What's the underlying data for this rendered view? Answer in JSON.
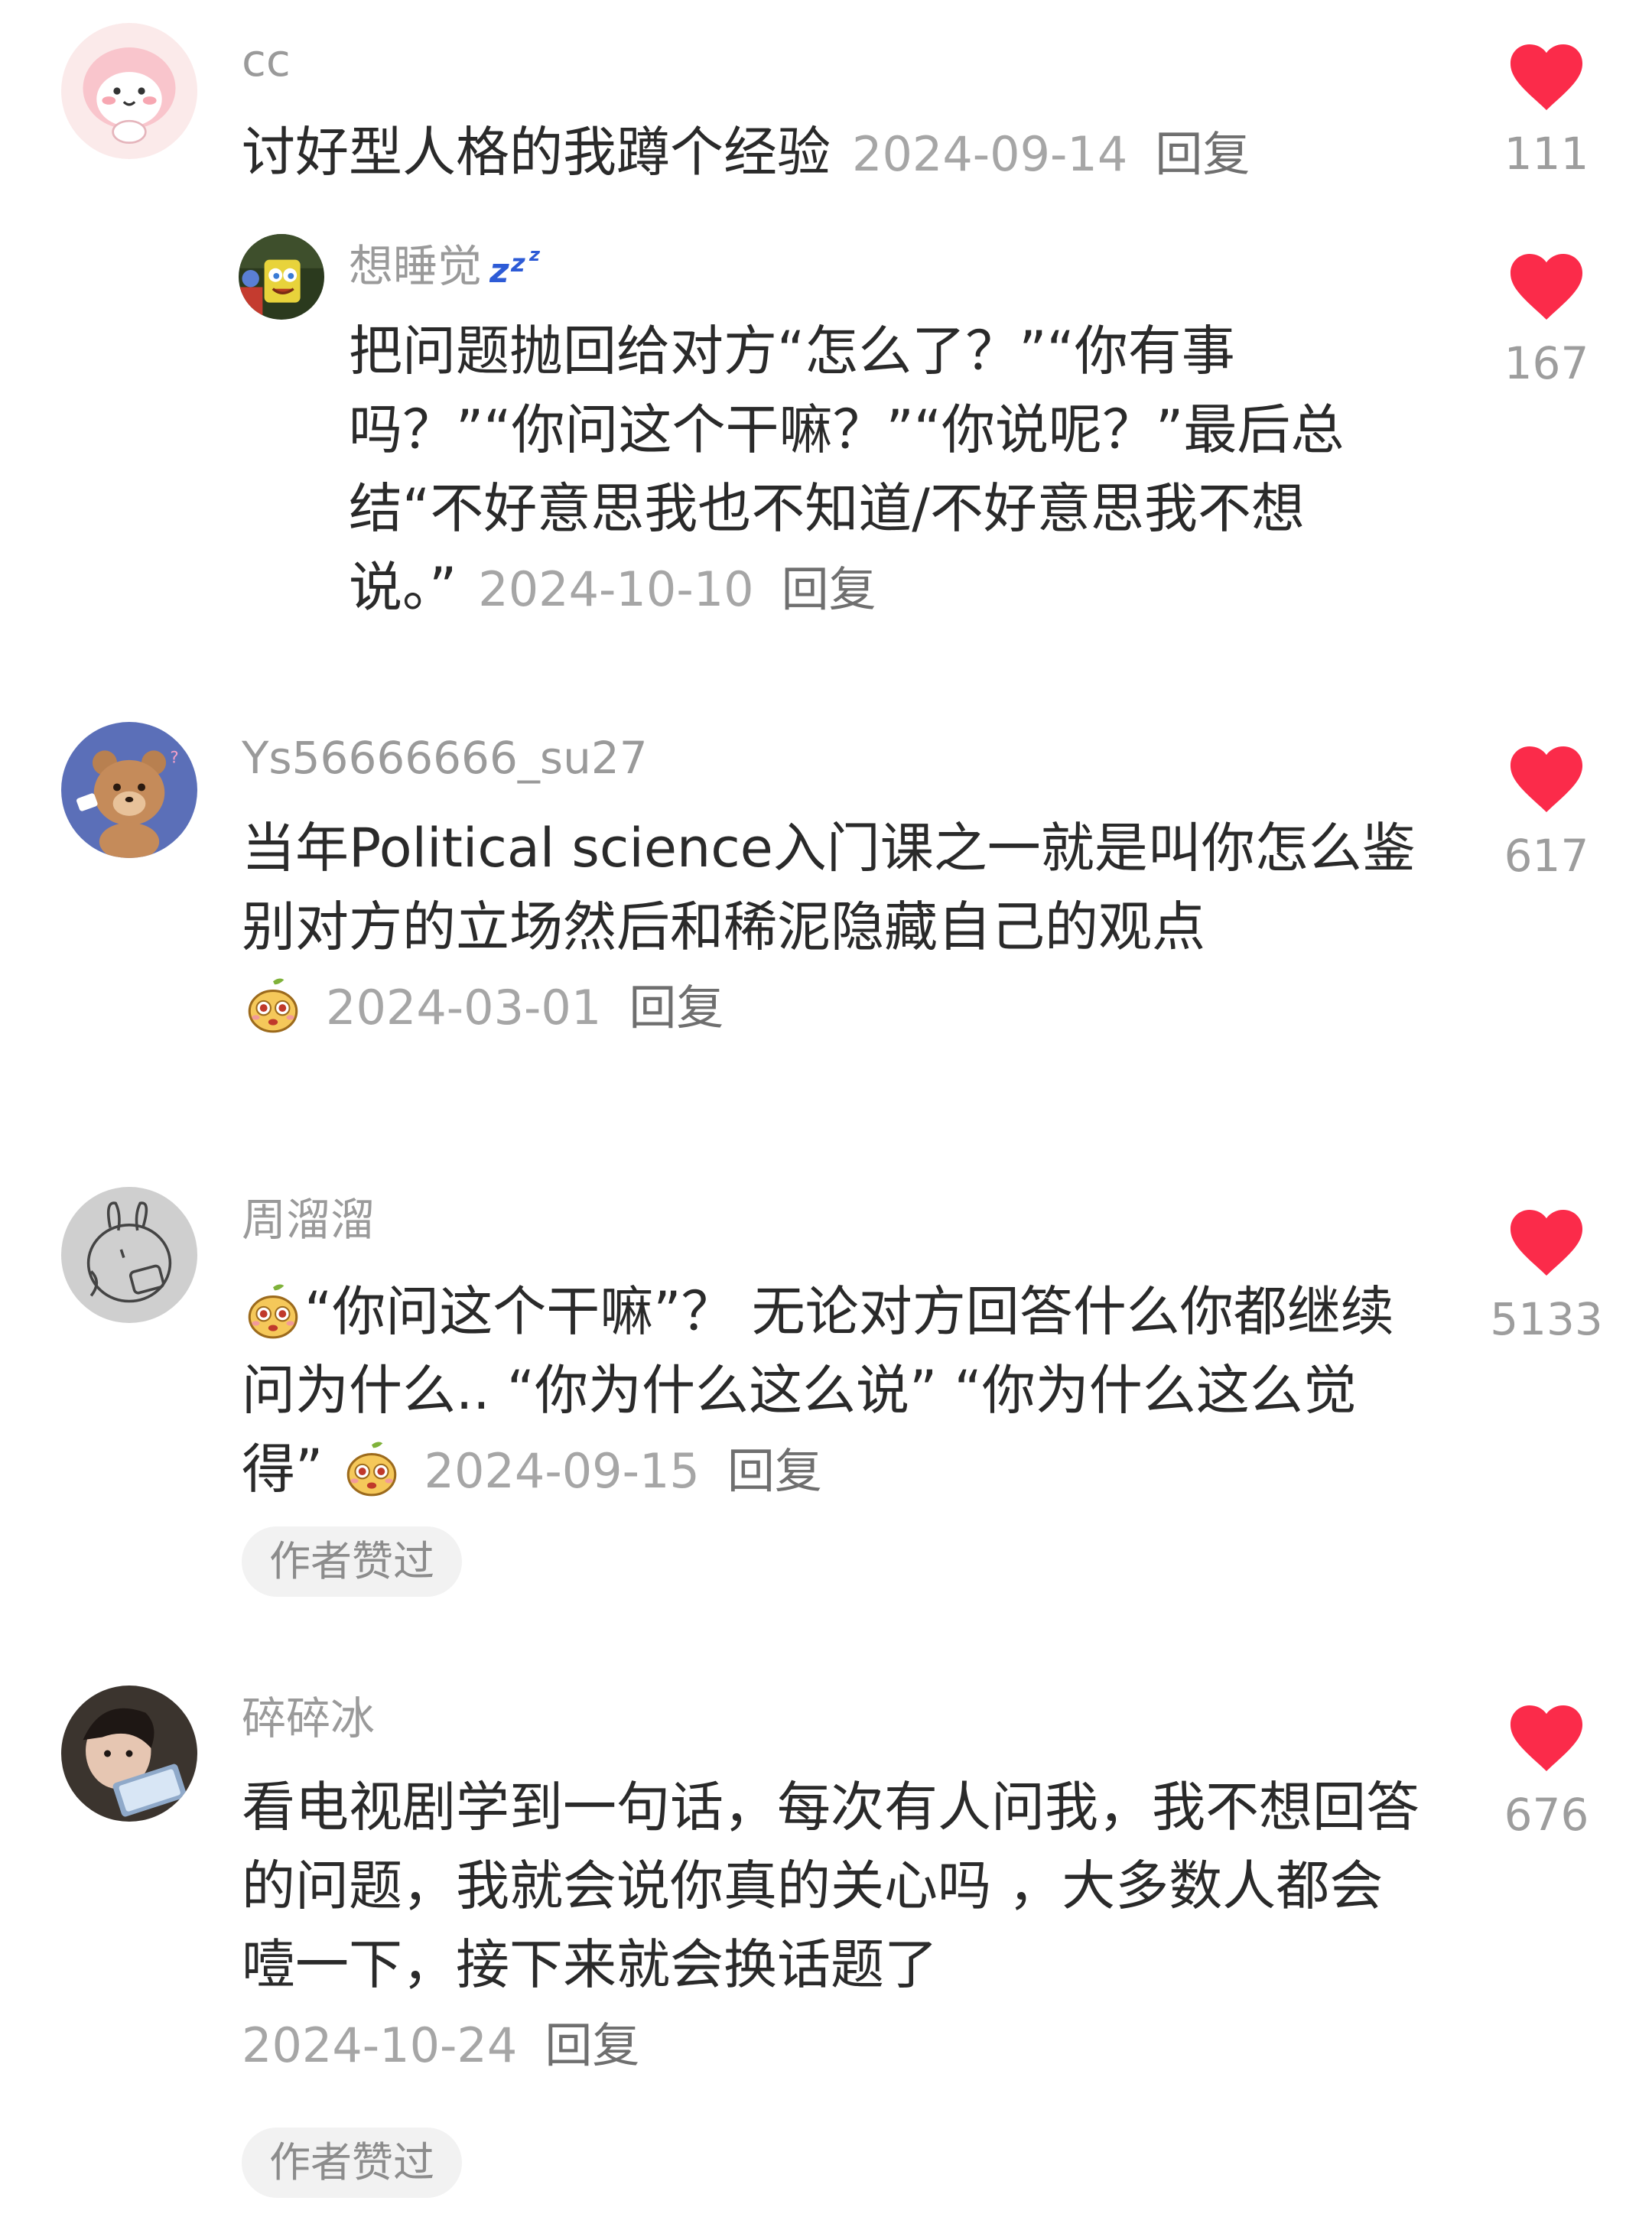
{
  "comments": [
    {
      "username": "cc",
      "text": "讨好型人格的我蹲个经验",
      "date": "2024-09-14",
      "reply_label": "回复",
      "likes": "111",
      "avatar": "pink-cartoon-avatar"
    },
    {
      "username": "想睡觉",
      "username_icon": "zzz-icon",
      "text": "把问题抛回给对方“怎么了？”“你有事吗？”“你问这个干嘛？”“你说呢？”最后总结“不好意思我也不知道/不好意思我不想说。”",
      "date": "2024-10-10",
      "reply_label": "回复",
      "likes": "167",
      "avatar": "spongebob-avatar"
    },
    {
      "username": "Ys56666666_su27",
      "text": "当年Political science入门课之一就是叫你怎么鉴别对方的立场然后和稀泥隐藏自己的观点",
      "emoji": "pear-face-emoji",
      "date": "2024-03-01",
      "reply_label": "回复",
      "likes": "617",
      "avatar": "bear-cartoon-avatar"
    },
    {
      "username": "周溜溜",
      "text": "“你问这个干嘛”？ 无论对方回答什么你都继续问为什么.. “你为什么这么说” “你为什么这么觉得”",
      "emoji": "pear-face-emoji",
      "date": "2024-09-15",
      "reply_label": "回复",
      "likes": "5133",
      "badge": "作者赞过",
      "avatar": "sketch-rabbit-avatar"
    },
    {
      "username": "碎碎冰",
      "text": "看电视剧学到一句话，每次有人问我，我不想回答的问题，我就会说你真的关心吗 ，大多数人都会噎一下，接下来就会换话题了",
      "date": "2024-10-24",
      "reply_label": "回复",
      "likes": "676",
      "badge": "作者赞过",
      "avatar": "girl-photo-avatar"
    }
  ],
  "colors": {
    "heart": "#fb2b4a",
    "username": "#9a9a9a",
    "text": "#2a2a2a",
    "meta": "#a6a6a6",
    "badge_bg": "#f2f2f2"
  }
}
